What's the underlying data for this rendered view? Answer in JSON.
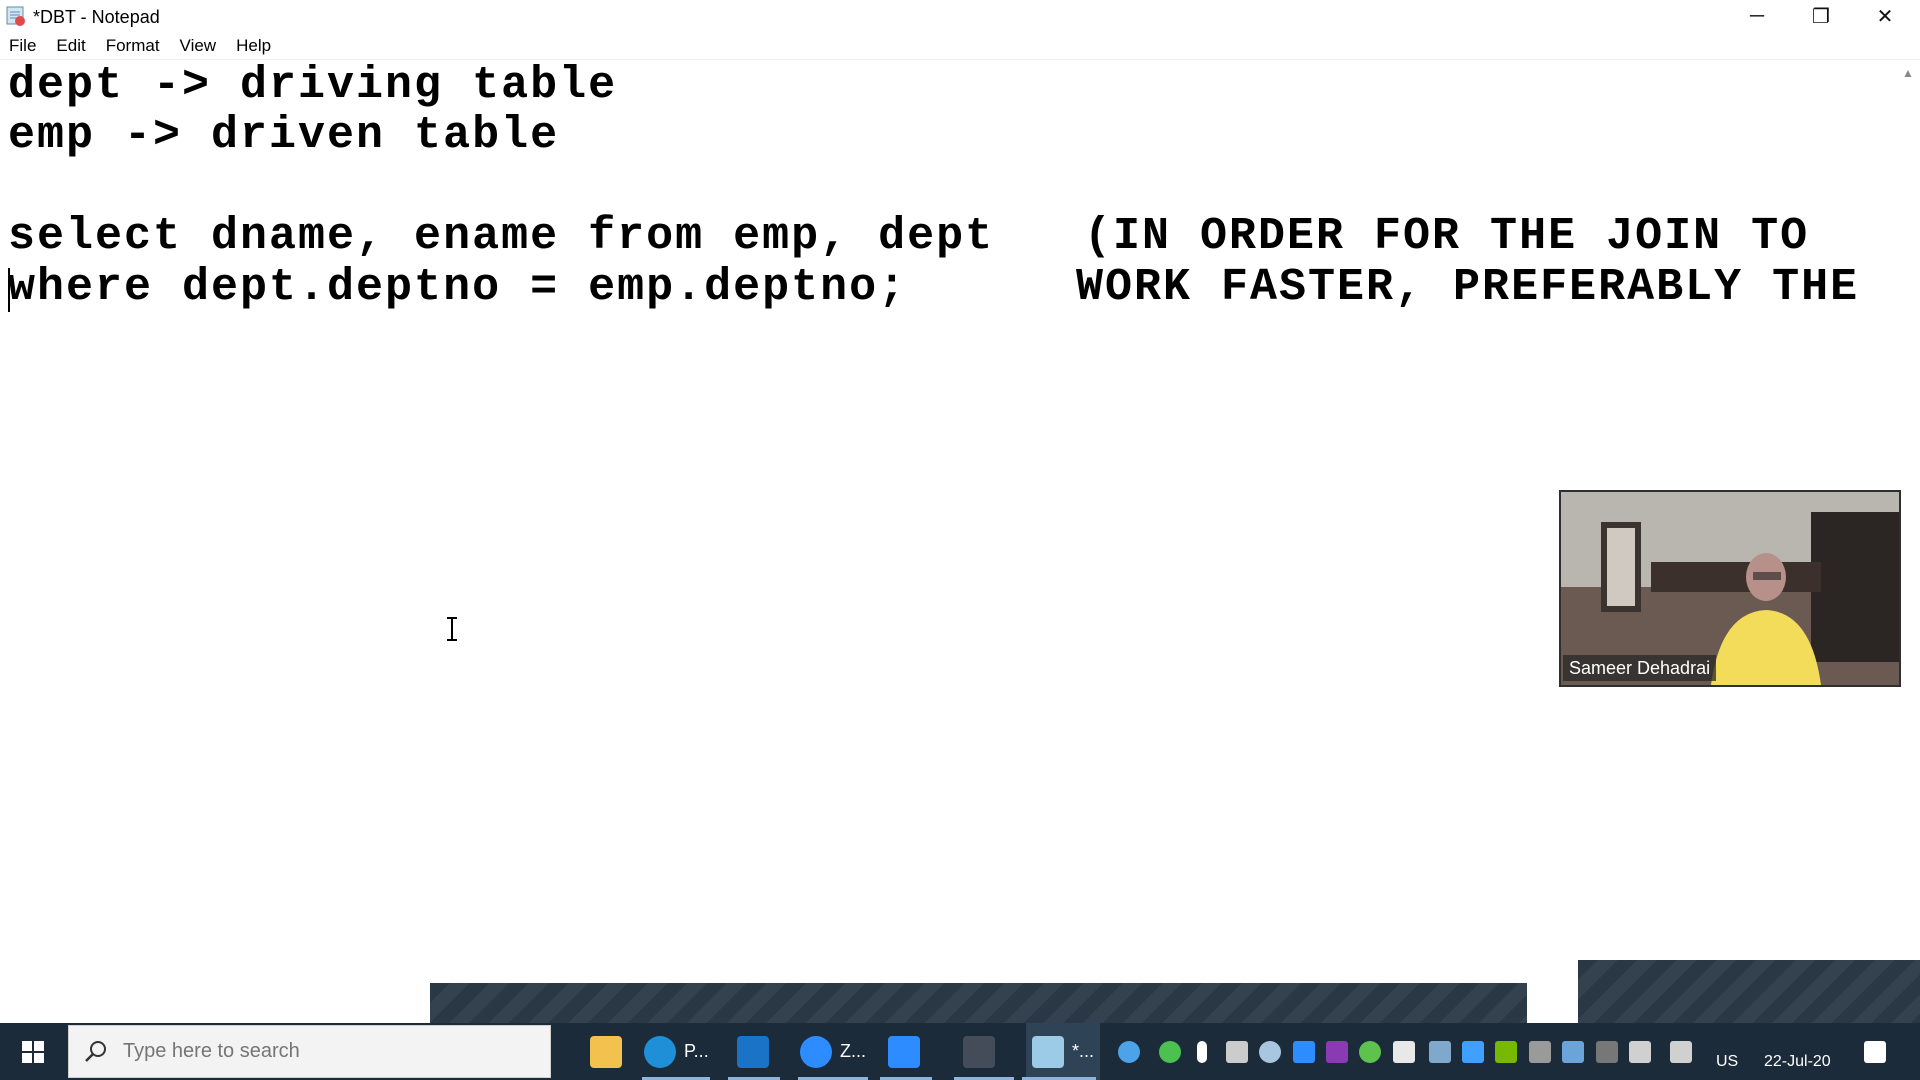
{
  "window": {
    "title": "*DBT - Notepad",
    "minimize_glyph": "─",
    "restore_glyph": "❐",
    "close_glyph": "✕"
  },
  "menu": [
    "File",
    "Edit",
    "Format",
    "View",
    "Help"
  ],
  "editor": {
    "lines": [
      "dept -> driving table",
      "emp -> driven table",
      "",
      "select dname, ename from emp, dept",
      "where dept.deptno = emp.deptno;"
    ],
    "note_lines": [
      "(IN ORDER FOR THE JOIN TO",
      "WORK FASTER, PREFERABLY THE"
    ]
  },
  "video": {
    "participant_name": "Sameer Dehadrai"
  },
  "taskbar": {
    "search_placeholder": "Type here to search",
    "apps": [
      {
        "label": "",
        "icon": "file-explorer-icon",
        "color": "#f2c14e"
      },
      {
        "label": "P...",
        "icon": "edge-icon",
        "color": "#1f8fd8"
      },
      {
        "label": "",
        "icon": "whiteboard-icon",
        "color": "#1a73c7"
      },
      {
        "label": "Z...",
        "icon": "zoom-icon",
        "color": "#2d8cff"
      },
      {
        "label": "",
        "icon": "zoom-meeting-icon",
        "color": "#2d8cff"
      },
      {
        "label": "",
        "icon": "sql-plus-icon",
        "color": "#444c5a"
      },
      {
        "label": "*...",
        "icon": "notepad-icon",
        "color": "#9ccbe8"
      }
    ],
    "tray": {
      "language": "US",
      "date": "22-Jul-20"
    }
  },
  "colors": {
    "taskbar": "#1b2b3a",
    "editor_bg": "#ffffff",
    "text": "#000000"
  }
}
